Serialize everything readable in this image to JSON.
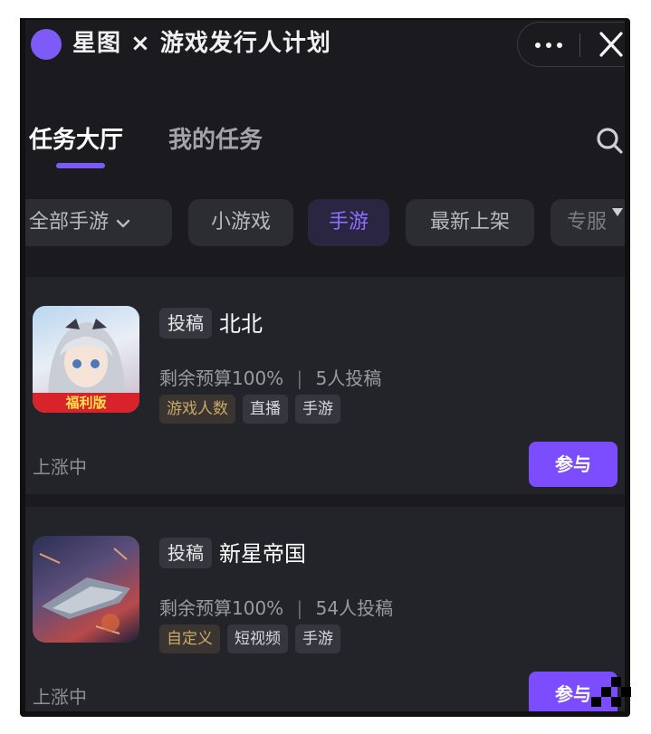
{
  "window": {
    "title": "星图 × 游戏发行人计划",
    "more_icon": "more-dots-icon",
    "close_icon": "close-icon"
  },
  "tabs": [
    {
      "label": "任务大厅",
      "active": true
    },
    {
      "label": "我的任务",
      "active": false
    }
  ],
  "search_icon": "search-icon",
  "filters": {
    "items": [
      {
        "label": "全部手游",
        "has_dropdown": true
      },
      {
        "label": "小游戏"
      },
      {
        "label": "手游",
        "selected": true
      },
      {
        "label": "最新上架"
      },
      {
        "label": "专服"
      }
    ]
  },
  "tasks": [
    {
      "type_tag": "投稿",
      "title": "北北",
      "budget": "剩余预算100%",
      "separator": "|",
      "submissions": "5人投稿",
      "labels": [
        "游戏人数",
        "直播",
        "手游"
      ],
      "cover_badge": "福利版",
      "status": "上涨中",
      "action": "参与"
    },
    {
      "type_tag": "投稿",
      "title": "新星帝国",
      "budget": "剩余预算100%",
      "separator": "|",
      "submissions": "54人投稿",
      "labels": [
        "自定义",
        "短视频",
        "手游"
      ],
      "status": "上涨中",
      "action": "参与"
    }
  ],
  "colors": {
    "accent": "#7b4dff",
    "background": "#1a1a1f",
    "card": "#23232a"
  }
}
